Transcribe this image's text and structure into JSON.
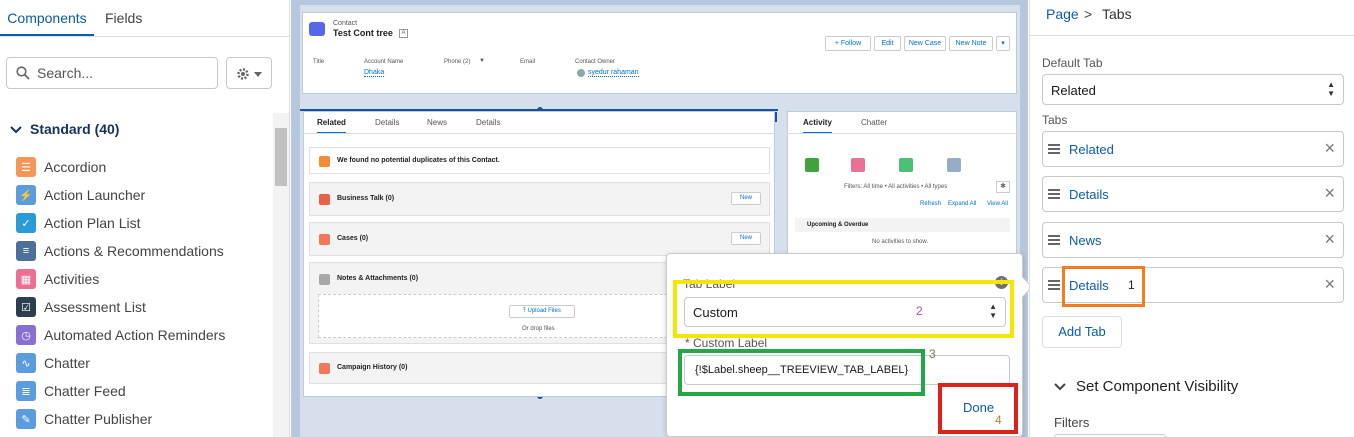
{
  "left_panel": {
    "tabs": [
      "Components",
      "Fields"
    ],
    "search_placeholder": "Search...",
    "section_title": "Standard (40)",
    "components": [
      {
        "label": "Accordion",
        "icon": "accordion-icon",
        "color": "#f49756"
      },
      {
        "label": "Action Launcher",
        "icon": "lightning-icon",
        "color": "#5a9cdd"
      },
      {
        "label": "Action Plan List",
        "icon": "action-plan-icon",
        "color": "#2a9bd4"
      },
      {
        "label": "Actions & Recommendations",
        "icon": "list-icon",
        "color": "#4d6f9c"
      },
      {
        "label": "Activities",
        "icon": "activities-icon",
        "color": "#eb7092"
      },
      {
        "label": "Assessment List",
        "icon": "checklist-icon",
        "color": "#2c3e50"
      },
      {
        "label": "Automated Action Reminders",
        "icon": "reminders-icon",
        "color": "#8a6fd3"
      },
      {
        "label": "Chatter",
        "icon": "pulse-icon",
        "color": "#5a9cdd"
      },
      {
        "label": "Chatter Feed",
        "icon": "feed-icon",
        "color": "#5a9cdd"
      },
      {
        "label": "Chatter Publisher",
        "icon": "publisher-icon",
        "color": "#5a9cdd"
      }
    ]
  },
  "canvas": {
    "header": {
      "object": "Contact",
      "name": "Test Cont tree",
      "buttons": [
        "+ Follow",
        "Edit",
        "New Case",
        "New Note"
      ],
      "fields": [
        {
          "label": "Title",
          "value": ""
        },
        {
          "label": "Account Name",
          "value": "Dhaka"
        },
        {
          "label": "Phone (2)",
          "value": ""
        },
        {
          "label": "Email",
          "value": ""
        },
        {
          "label": "Contact Owner",
          "value": "syedur rahaman"
        }
      ]
    },
    "related_tabs": [
      "Related",
      "Details",
      "News",
      "Details"
    ],
    "duplicates_text": "We found no potential duplicates of this Contact.",
    "cards": [
      {
        "title": "Business Talk (0)",
        "button": "New",
        "color": "#e8624a"
      },
      {
        "title": "Cases (0)",
        "button": "New",
        "color": "#f2785c"
      },
      {
        "title": "Notes & Attachments (0)",
        "button": "",
        "color": "#a8a8a8"
      },
      {
        "title": "Campaign History (0)",
        "button": "",
        "color": "#f2785c"
      }
    ],
    "upload_label": "Upload Files",
    "drop_label": "Or drop files",
    "activity_tabs": [
      "Activity",
      "Chatter"
    ],
    "activity_filters": "Filters: All time • All activities • All types",
    "activity_links": [
      "Refresh",
      "Expand All",
      "View All"
    ],
    "upcoming_label": "Upcoming & Overdue",
    "no_activities": "No activities to show."
  },
  "popover": {
    "tab_label_title": "Tab Label",
    "tab_label_value": "Custom",
    "custom_label_title": "Custom Label",
    "custom_label_value": "{!$Label.sheep__TREEVIEW_TAB_LABEL}",
    "done_label": "Done"
  },
  "right_panel": {
    "breadcrumb_page": "Page",
    "breadcrumb_sep": ">",
    "breadcrumb_current": "Tabs",
    "default_tab_label": "Default Tab",
    "default_tab_value": "Related",
    "tabs_label": "Tabs",
    "tabs": [
      "Related",
      "Details",
      "News",
      "Details"
    ],
    "add_tab_label": "Add Tab",
    "visibility_label": "Set Component Visibility",
    "filters_label": "Filters"
  },
  "annotations": {
    "numbers": [
      "1",
      "2",
      "3",
      "4"
    ],
    "colors": {
      "orange": "#f47b20",
      "yellow": "#f5e500",
      "green": "#22a845",
      "red": "#e0201b"
    }
  }
}
